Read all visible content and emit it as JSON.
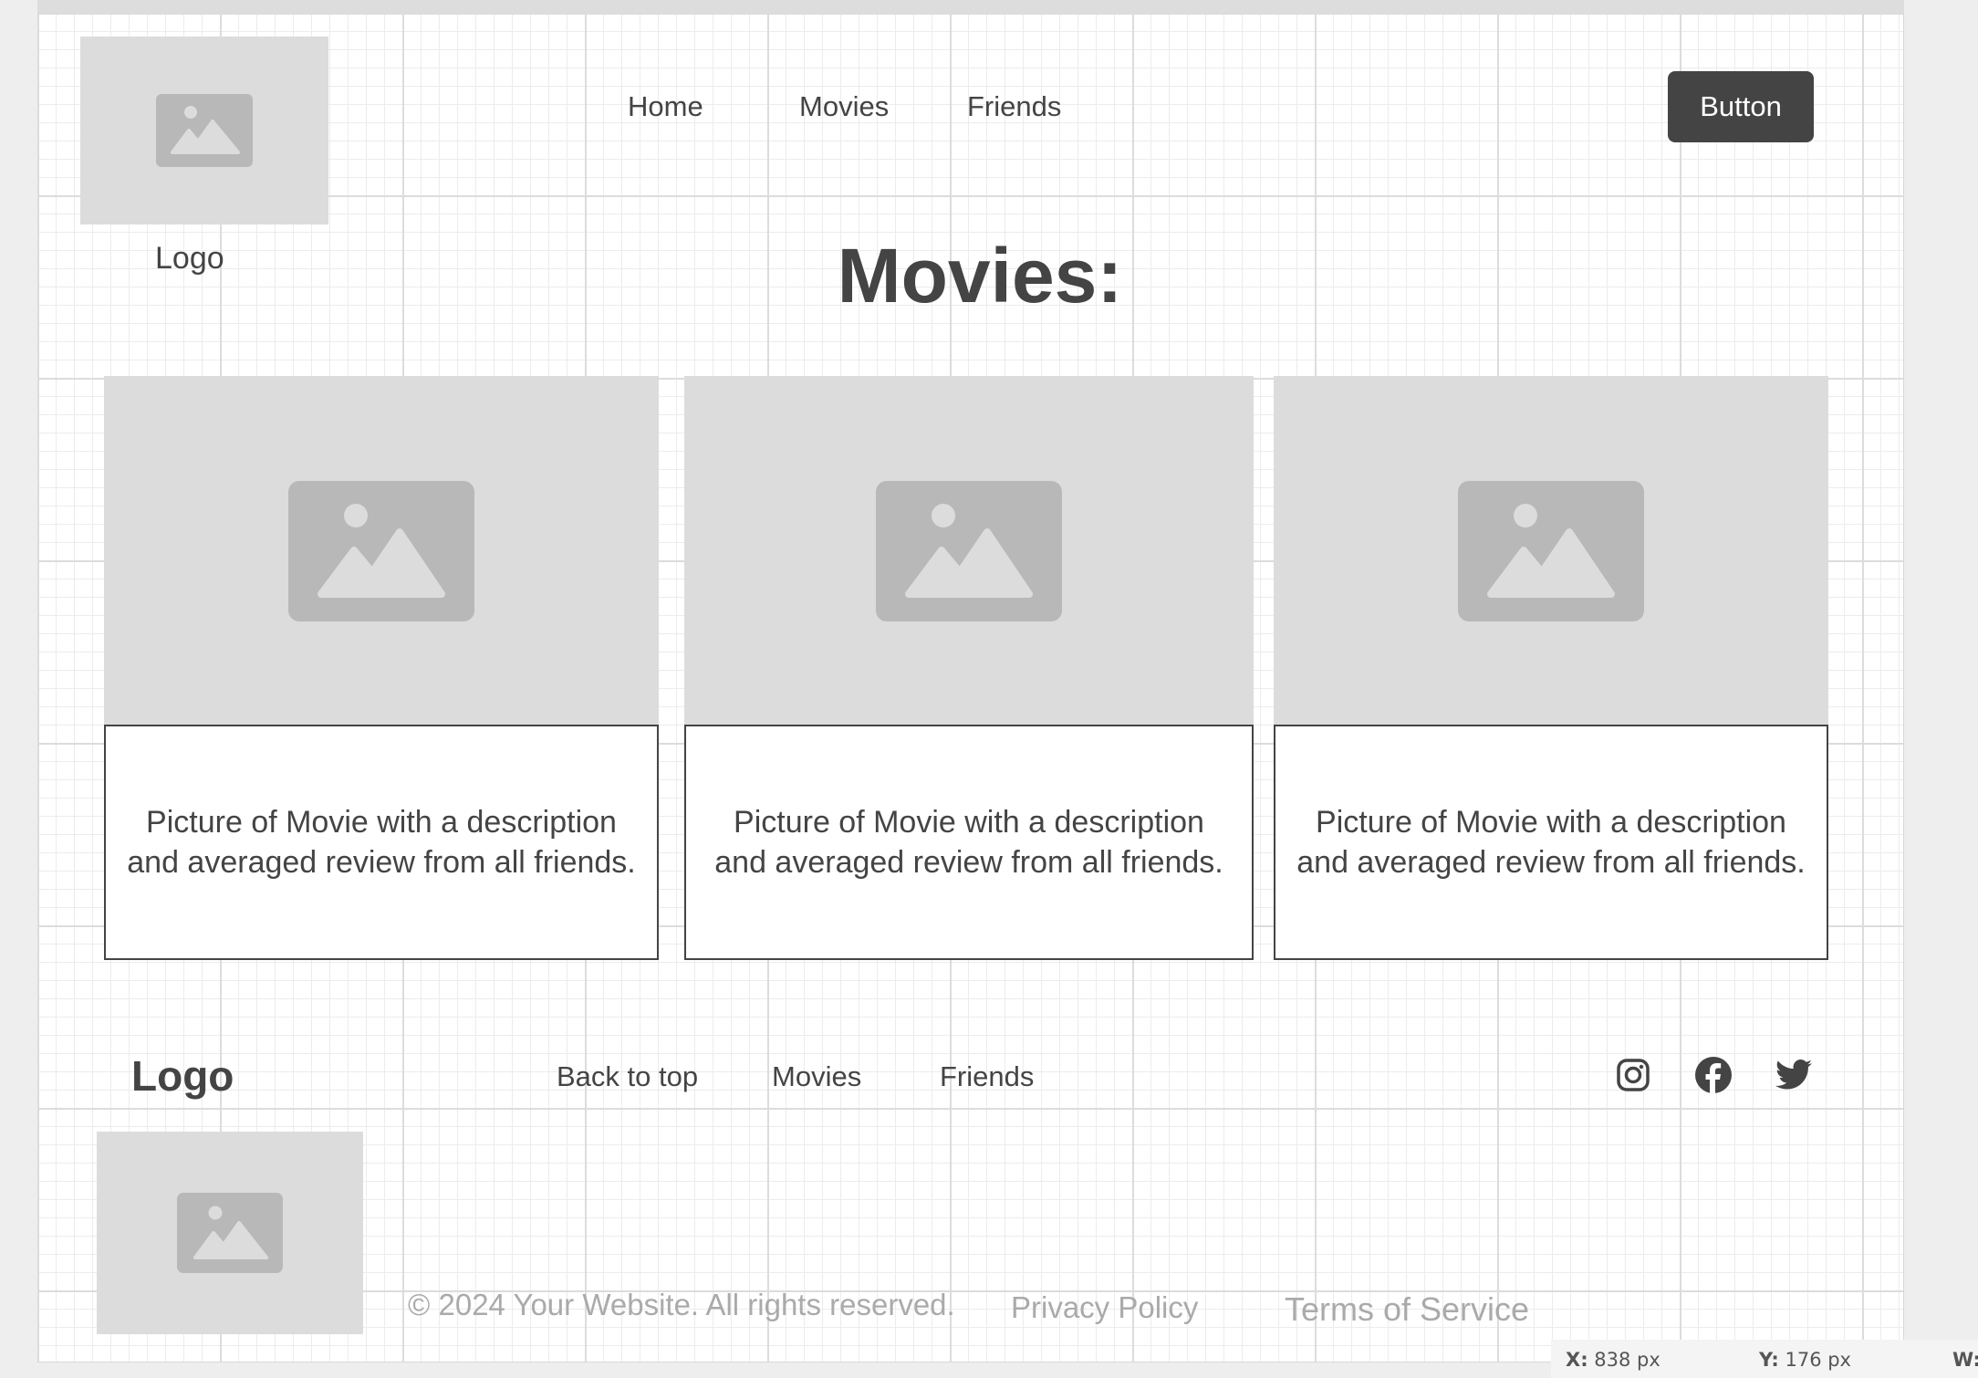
{
  "header": {
    "logo_label": "Logo",
    "nav": [
      "Home",
      "Movies",
      "Friends"
    ],
    "button_label": "Button"
  },
  "main": {
    "title": "Movies:",
    "cards": [
      {
        "description": "Picture of Movie with a description and averaged review from all friends."
      },
      {
        "description": "Picture of Movie with a description and averaged review from all friends."
      },
      {
        "description": "Picture of Movie with a description and averaged review from all friends."
      }
    ]
  },
  "footer": {
    "logo_label": "Logo",
    "links": [
      "Back to top",
      "Movies",
      "Friends"
    ],
    "social_icons": [
      "instagram-icon",
      "facebook-icon",
      "twitter-icon"
    ],
    "copyright": "© 2024 Your Website. All rights reserved.",
    "privacy": "Privacy Policy",
    "terms": "Terms of Service"
  },
  "status_bar": {
    "x_label": "X:",
    "x_value": "838 px",
    "y_label": "Y:",
    "y_value": "176 px",
    "w_label": "W:"
  },
  "colors": {
    "placeholder": "#dcdcdc",
    "placeholder_icon": "#b8b8b8",
    "text": "#444444",
    "button": "#444444",
    "muted_text": "#aaaaaa"
  }
}
